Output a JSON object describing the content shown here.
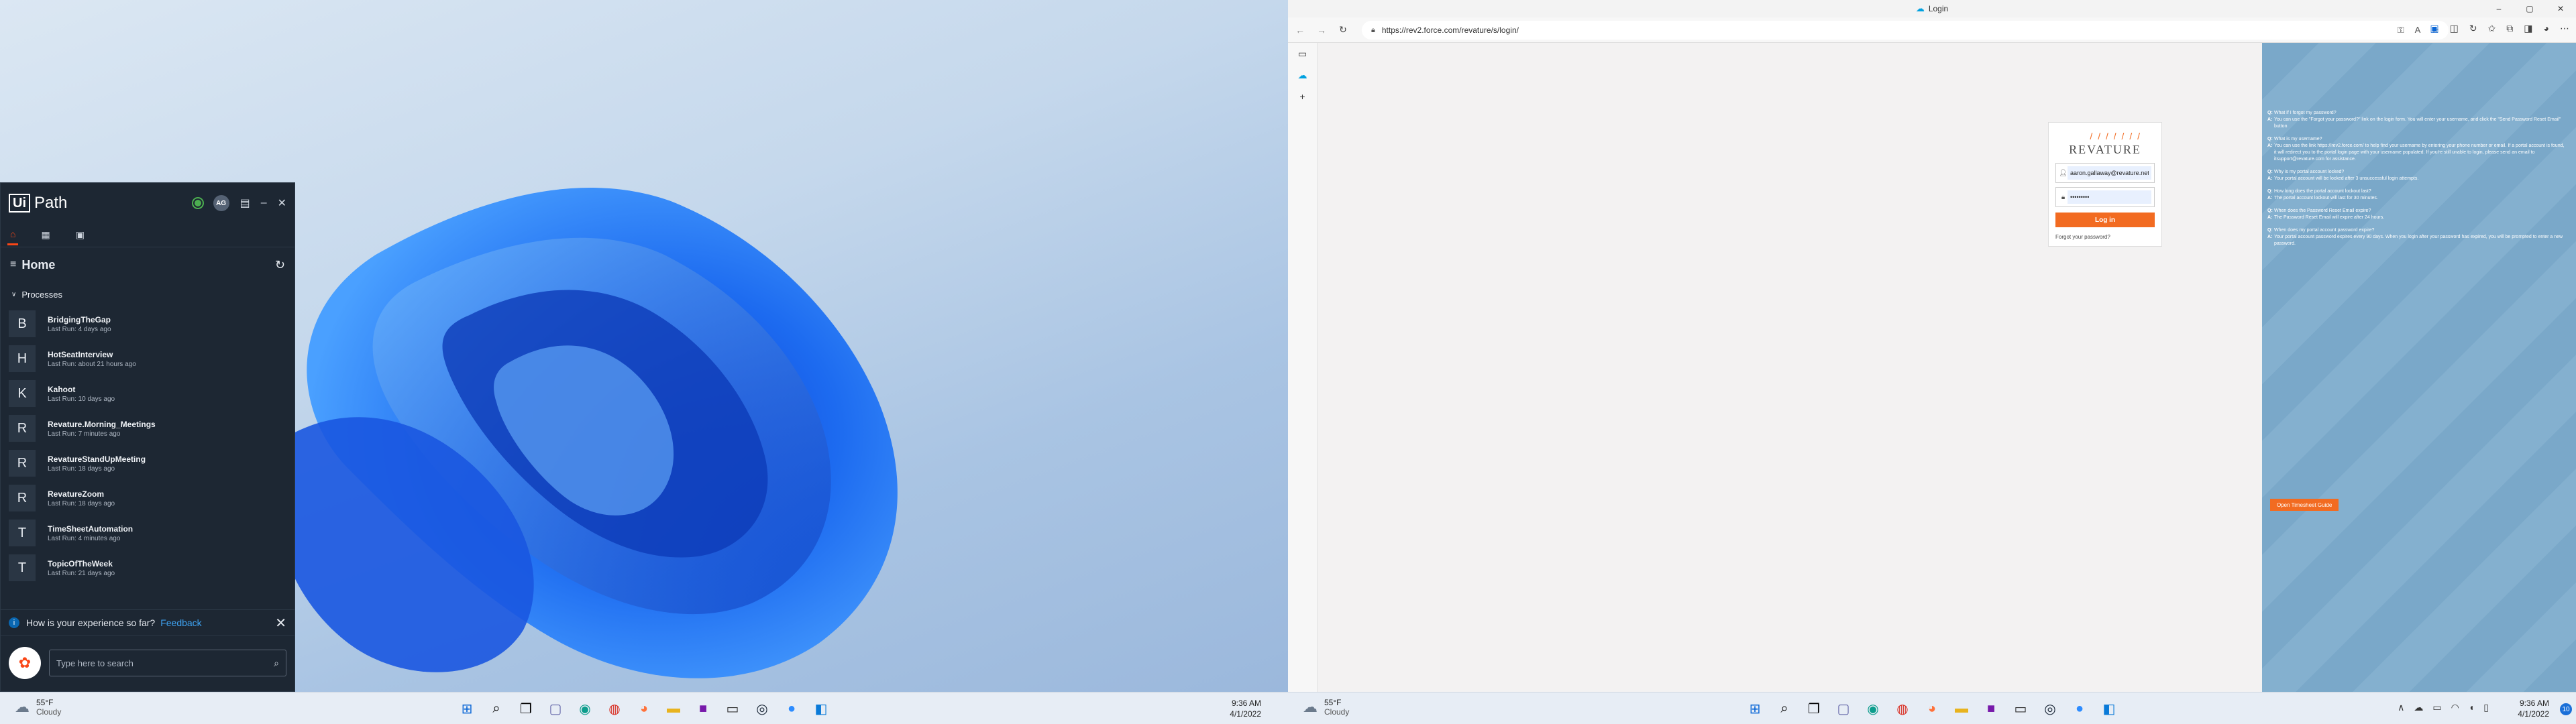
{
  "uipath": {
    "logo_box": "Ui",
    "logo_text": "Path",
    "avatar_initials": "AG",
    "home_title": "Home",
    "processes_label": "Processes",
    "processes": [
      {
        "letter": "B",
        "name": "BridgingTheGap",
        "last_run": "Last Run: 4 days ago"
      },
      {
        "letter": "H",
        "name": "HotSeatInterview",
        "last_run": "Last Run: about 21 hours ago"
      },
      {
        "letter": "K",
        "name": "Kahoot",
        "last_run": "Last Run: 10 days ago"
      },
      {
        "letter": "R",
        "name": "Revature.Morning_Meetings",
        "last_run": "Last Run: 7 minutes ago"
      },
      {
        "letter": "R",
        "name": "RevatureStandUpMeeting",
        "last_run": "Last Run: 18 days ago"
      },
      {
        "letter": "R",
        "name": "RevatureZoom",
        "last_run": "Last Run: 18 days ago"
      },
      {
        "letter": "T",
        "name": "TimeSheetAutomation",
        "last_run": "Last Run: 4 minutes ago"
      },
      {
        "letter": "T",
        "name": "TopicOfTheWeek",
        "last_run": "Last Run: 21 days ago"
      }
    ],
    "feedback_text": "How is your experience so far?",
    "feedback_link": "Feedback",
    "search_placeholder": "Type here to search"
  },
  "taskbar": {
    "temperature": "55°F",
    "condition": "Cloudy",
    "time": "9:36 AM",
    "date": "4/1/2022",
    "notification_count": "10"
  },
  "browser": {
    "tab_title": "Login",
    "url": "https://rev2.force.com/revature/s/login/"
  },
  "login": {
    "brand": "REVATURE",
    "username_value": "aaron.gallaway@revature.net",
    "password_value": "•••••••••",
    "login_button": "Log in",
    "forgot_link": "Forgot your password?"
  },
  "faq": [
    {
      "q": "What if I forgot my password?",
      "a": "You can use the \"Forgot your password?\" link on the login form. You will enter your username, and click the \"Send Password Reset Email\" button"
    },
    {
      "q": "What is my username?",
      "a": "You can use the link https://rev2.force.com/ to help find your username by entering your phone number or email. If a portal account is found, it will redirect you to the portal login page with your username populated. If you're still unable to login, please send an email to itsupport@revature.com for assistance."
    },
    {
      "q": "Why is my portal account locked?",
      "a": "Your portal account will be locked after 3 unsuccessful login attempts."
    },
    {
      "q": "How long does the portal account lockout last?",
      "a": "The portal account lockout will last for 30 minutes."
    },
    {
      "q": "When does the Password Reset Email expire?",
      "a": "The Password Reset Email will expire after 24 hours."
    },
    {
      "q": "When does my portal account password expire?",
      "a": "Your portal account password expires every 90 days. When you login after your password has expired, you will be prompted to enter a new password."
    }
  ],
  "guide_button": "Open Timesheet Guide",
  "colors": {
    "accent": "#f26b21",
    "uipath_bg": "#1d2733",
    "uipath_accent": "#fa4616"
  }
}
